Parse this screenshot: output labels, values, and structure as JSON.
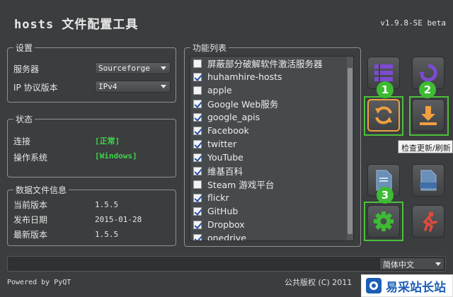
{
  "app": {
    "title": "hosts 文件配置工具",
    "version": "v1.9.8-SE beta"
  },
  "settings": {
    "legend": "设置",
    "server_label": "服务器",
    "server_value": "Sourceforge",
    "ipver_label": "IP 协议版本",
    "ipver_value": "IPv4"
  },
  "status": {
    "legend": "状态",
    "conn_label": "连接",
    "conn_value": "[正常]",
    "os_label": "操作系统",
    "os_value": "[Windows]"
  },
  "datafile": {
    "legend": "数据文件信息",
    "cur_label": "当前版本",
    "cur_value": "1.5.5",
    "date_label": "发布日期",
    "date_value": "2015-01-28",
    "latest_label": "最新版本",
    "latest_value": "1.5.5"
  },
  "functions": {
    "legend": "功能列表",
    "items": [
      {
        "label": "屏蔽部分破解软件激活服务器",
        "checked": false
      },
      {
        "label": "huhamhire-hosts",
        "checked": true
      },
      {
        "label": "apple",
        "checked": false
      },
      {
        "label": "Google Web服务",
        "checked": true
      },
      {
        "label": "google_apis",
        "checked": true
      },
      {
        "label": "Facebook",
        "checked": true
      },
      {
        "label": "twitter",
        "checked": true
      },
      {
        "label": "YouTube",
        "checked": true
      },
      {
        "label": "维基百科",
        "checked": true
      },
      {
        "label": "Steam 游戏平台",
        "checked": false
      },
      {
        "label": "flickr",
        "checked": true
      },
      {
        "label": "GitHub",
        "checked": true
      },
      {
        "label": "Dropbox",
        "checked": true
      },
      {
        "label": "onedrive",
        "checked": true
      }
    ]
  },
  "badges": {
    "one": "1",
    "two": "2",
    "three": "3"
  },
  "tooltip": "检查更新/刷新",
  "language": "简体中文",
  "footer": {
    "left": "Powered by PyQT",
    "right": "公共版权 (C) 2011"
  },
  "watermark": "易采站长站",
  "colors": {
    "highlight": "#4cc03a",
    "accent_orange": "#f0a040",
    "accent_purple": "#7b4bd0",
    "accent_red": "#e24a3a",
    "accent_green": "#3fd34a"
  }
}
